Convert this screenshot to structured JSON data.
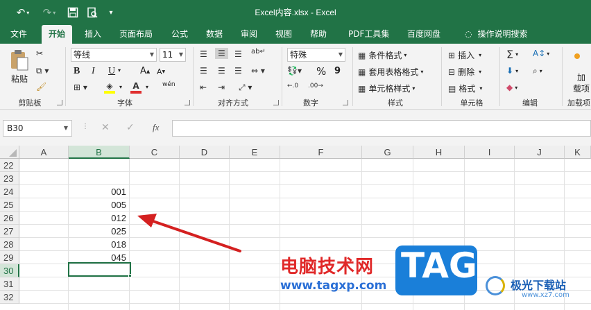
{
  "window": {
    "title": "Excel内容.xlsx  -  Excel"
  },
  "quick_access": {
    "undo": "↶",
    "redo": "↷",
    "save": "save-icon",
    "preview": "print-preview-icon",
    "customize": "▾"
  },
  "menu": {
    "tabs": [
      "文件",
      "开始",
      "插入",
      "页面布局",
      "公式",
      "数据",
      "审阅",
      "视图",
      "帮助",
      "PDF工具集",
      "百度网盘"
    ],
    "active": "开始",
    "tell_me": "操作说明搜索"
  },
  "ribbon": {
    "clipboard": {
      "paste": "粘贴",
      "label": "剪贴板"
    },
    "font": {
      "name": "等线",
      "size": "11",
      "bold": "B",
      "italic": "I",
      "underline": "U",
      "grow": "A",
      "shrink": "A",
      "wen": "wén",
      "label": "字体"
    },
    "alignment": {
      "label": "对齐方式"
    },
    "number": {
      "format": "特殊",
      "percent": "%",
      "comma": "9",
      "label": "数字"
    },
    "styles": {
      "conditional": "条件格式",
      "table": "套用表格格式",
      "cell_styles": "单元格样式",
      "label": "样式"
    },
    "cells": {
      "insert": "插入",
      "delete": "删除",
      "format": "格式",
      "label": "单元格"
    },
    "editing": {
      "label": "编辑"
    },
    "addins": {
      "line1": "加",
      "line2": "载项",
      "label": "加载项"
    }
  },
  "formula_bar": {
    "name_box": "B30",
    "cancel": "✕",
    "confirm": "✓",
    "fx": "fx",
    "content": ""
  },
  "sheet": {
    "columns": [
      "A",
      "B",
      "C",
      "D",
      "E",
      "F",
      "G",
      "H",
      "I",
      "J",
      "K"
    ],
    "selected_column": "B",
    "rows": [
      "22",
      "23",
      "24",
      "25",
      "26",
      "27",
      "28",
      "29",
      "30",
      "31",
      "32"
    ],
    "selected_row": "30",
    "b_values": [
      "",
      "",
      "001",
      "005",
      "012",
      "025",
      "018",
      "045",
      "",
      "",
      ""
    ]
  },
  "watermark": {
    "site_cn": "电脑技术网",
    "site_url": "www.tagxp.com",
    "logo": "TAG",
    "corner_cn": "极光下载站",
    "corner_url": "www.xz7.com"
  },
  "colors": {
    "excel_green": "#217346",
    "arrow_red": "#d42020",
    "tag_blue": "#1a7fd9"
  }
}
